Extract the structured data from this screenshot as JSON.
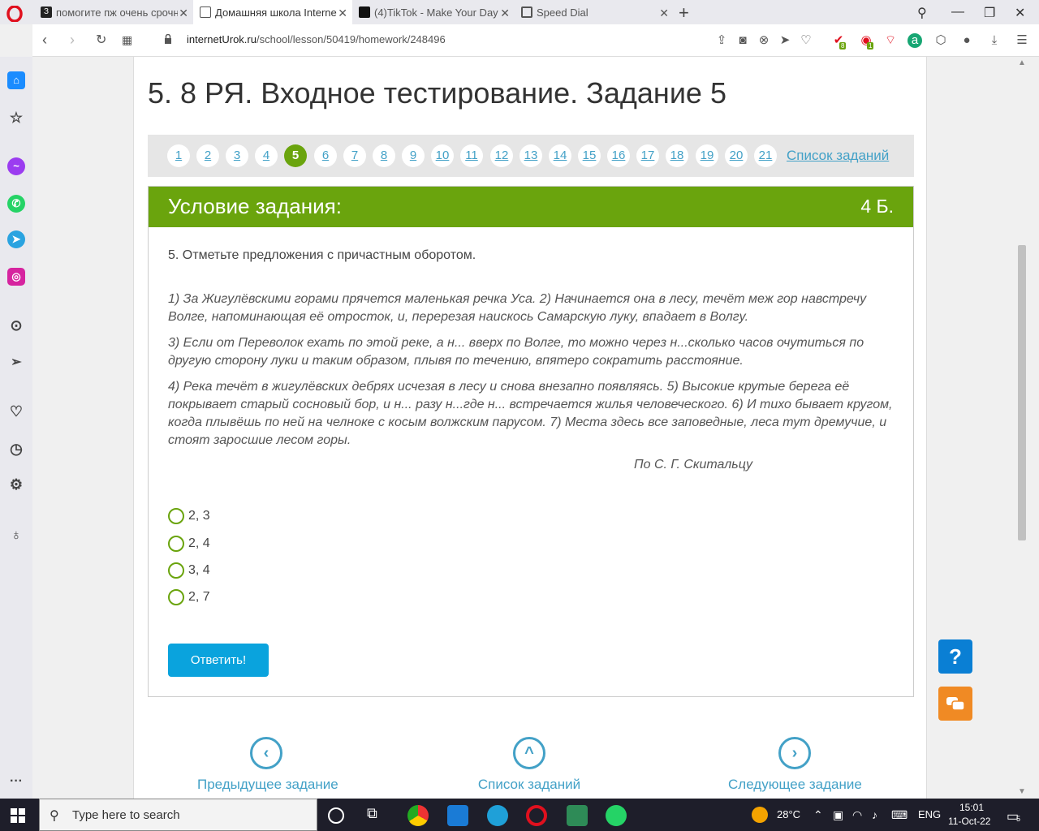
{
  "browser": {
    "tabs": [
      {
        "title": "помогите пж очень срочн",
        "state": "inactive"
      },
      {
        "title": "Домашняя школа Internet",
        "state": "active"
      },
      {
        "title": "(4)TikTok - Make Your Day",
        "state": "inactive"
      },
      {
        "title": "Speed Dial",
        "state": "inactive"
      }
    ],
    "url_domain": "internetUrok.ru",
    "url_path": "/school/lesson/50419/homework/248496",
    "ext_badges": {
      "badge1": "8",
      "badge2": "1"
    }
  },
  "page": {
    "title": "5. 8 РЯ. Входное тестирование. Задание 5",
    "pager": {
      "pages": [
        "1",
        "2",
        "3",
        "4",
        "5",
        "6",
        "7",
        "8",
        "9",
        "10",
        "11",
        "12",
        "13",
        "14",
        "15",
        "16",
        "17",
        "18",
        "19",
        "20",
        "21"
      ],
      "active": "5",
      "list_label": "Список заданий"
    },
    "task": {
      "header": "Условие задания:",
      "points": "4 Б.",
      "question": "5. Отметьте предложения с причастным оборотом.",
      "paragraphs": [
        "1) За Жигулёвскими горами прячется маленькая речка Уса. 2) Начинается она в лесу, течёт меж гор навстречу Волге, напоминающая её отросток, и, перерезая наискось Самарскую луку, впадает в Волгу.",
        "3) Если от Переволок ехать по этой реке, а н... вверх по Волге, то можно через н...сколько часов очутиться по другую сторону луки и таким образом, плывя по течению, впятеро сократить расстояние.",
        "4) Река течёт в жигулёвских дебрях исчезая в лесу и снова внезапно появляясь. 5) Высокие крутые берега её покрывает старый сосновый бор, и н... разу н...где н... встречается жилья человеческого. 6) И тихо бывает кругом, когда плывёшь по ней на челноке с косым волжским парусом. 7) Места здесь все заповедные, леса тут дремучие, и стоят заросшие лесом горы."
      ],
      "author": "По С. Г. Скитальцу",
      "options": [
        "2, 3",
        "2, 4",
        "3, 4",
        "2, 7"
      ],
      "submit": "Ответить!"
    },
    "bottom_nav": {
      "prev": "Предыдущее задание",
      "list": "Список заданий",
      "next": "Следующее задание"
    },
    "help": "?"
  },
  "taskbar": {
    "search_placeholder": "Type here to search",
    "weather": "28°C",
    "lang": "ENG",
    "time": "15:01",
    "date": "11-Oct-22",
    "notifications": "5"
  },
  "colors": {
    "green": "#6aa40d",
    "link": "#43a1c7",
    "button": "#0aa3dd"
  }
}
